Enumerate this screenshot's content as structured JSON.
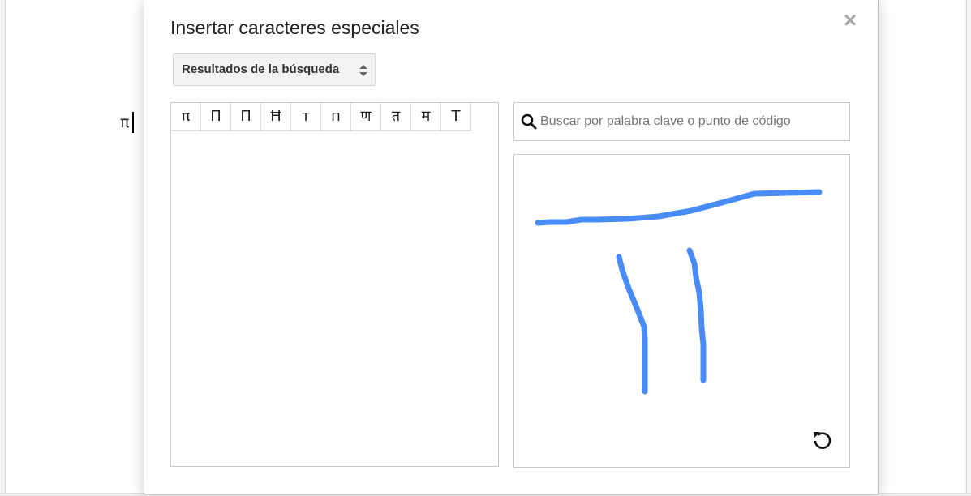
{
  "document": {
    "text": "π"
  },
  "dialog": {
    "title": "Insertar caracteres especiales",
    "close_icon": "close-icon",
    "category_select": {
      "selected": "Resultados de la búsqueda"
    },
    "results": {
      "characters": [
        "π",
        "Π",
        "П",
        "Ħ",
        "т",
        "п",
        "ण",
        "त",
        "म",
        "T"
      ]
    },
    "search": {
      "placeholder": "Buscar por palabra clave o punto de código",
      "value": "",
      "icon": "search-icon"
    },
    "drawing": {
      "stroke_color": "#4a8cf7",
      "reset_icon": "undo-icon"
    }
  }
}
